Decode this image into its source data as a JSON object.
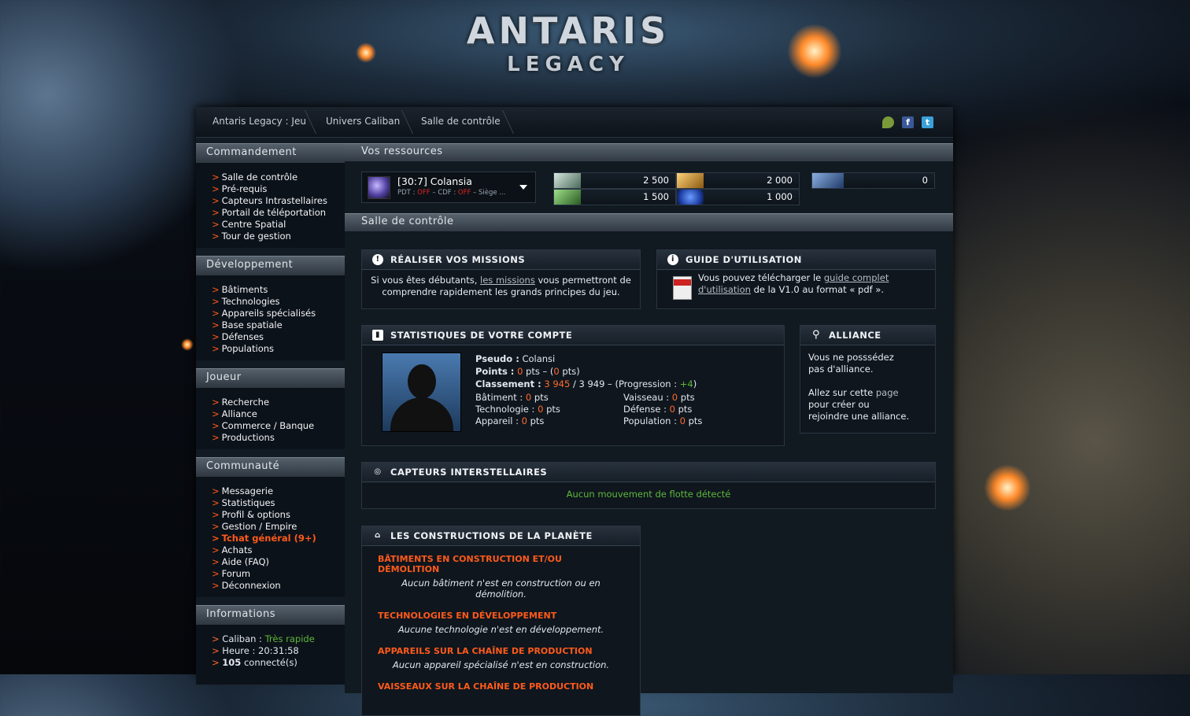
{
  "logo": {
    "line1": "ANTARIS",
    "line2": "LEGACY"
  },
  "breadcrumb": [
    "Antaris Legacy : Jeu",
    "Univers Caliban",
    "Salle de contrôle"
  ],
  "social": {
    "facebook": "f",
    "twitter": "t"
  },
  "sidebar": {
    "commandement": {
      "title": "Commandement",
      "items": [
        "Salle de contrôle",
        "Pré-requis",
        "Capteurs Intrastellaires",
        "Portail de téléportation",
        "Centre Spatial",
        "Tour de gestion"
      ]
    },
    "developpement": {
      "title": "Développement",
      "items": [
        "Bâtiments",
        "Technologies",
        "Appareils spécialisés",
        "Base spatiale",
        "Défenses",
        "Populations"
      ]
    },
    "joueur": {
      "title": "Joueur",
      "items": [
        "Recherche",
        "Alliance",
        "Commerce / Banque",
        "Productions"
      ]
    },
    "communaute": {
      "title": "Communauté",
      "items": [
        "Messagerie",
        "Statistiques",
        "Profil & options",
        "Gestion / Empire",
        "Tchat général (9+)",
        "Achats",
        "Aide (FAQ)",
        "Forum",
        "Déconnexion"
      ]
    },
    "informations": {
      "title": "Informations",
      "universe_label": "Caliban :",
      "universe_speed": "Très rapide",
      "time_label": "Heure :",
      "time_value": "20:31:58",
      "connected_count": "105",
      "connected_label": "connecté(s)"
    }
  },
  "resources": {
    "title": "Vos ressources",
    "planet": {
      "name": "[30:7] Colansia",
      "pdt_label": "PDT :",
      "pdt_value": "OFF",
      "sep": "–",
      "cdf_label": "CDF :",
      "cdf_value": "OFF",
      "seat": "– Siège ..."
    },
    "values": {
      "r1": "2 500",
      "r2": "1 500",
      "r3": "2 000",
      "r4": "1 000",
      "r5": "0"
    },
    "colors": {
      "metal": "#8fb7a0",
      "crystal": "#d8a02a",
      "blue": "#2a62d8"
    }
  },
  "control": {
    "title": "Salle de contrôle",
    "missions": {
      "title": "RÉALISER VOS MISSIONS",
      "text1": "Si vous êtes débutants,",
      "link": "les missions",
      "text2": "vous permettront de comprendre rapidement les grands principes du jeu."
    },
    "guide": {
      "title": "GUIDE D'UTILISATION",
      "text1": "Vous pouvez télécharger le",
      "link": "guide complet d'utilisation",
      "text2": "de la V1.0 au format « pdf »."
    },
    "stats": {
      "title": "STATISTIQUES DE VOTRE COMPTE",
      "pseudo_label": "Pseudo :",
      "pseudo": "Colansi",
      "points_label": "Points :",
      "points": "0",
      "points_unit": "pts – (",
      "points_sub": "0",
      "points_end": "pts)",
      "rank_label": "Classement :",
      "rank": "3 945",
      "rank_total": "/ 3 949 – (Progression :",
      "rank_prog": "+4",
      "rank_end": ")",
      "grid": [
        {
          "label": "Bâtiment :",
          "value": "0",
          "unit": "pts"
        },
        {
          "label": "Vaisseau :",
          "value": "0",
          "unit": "pts"
        },
        {
          "label": "Technologie :",
          "value": "0",
          "unit": "pts"
        },
        {
          "label": "Défense :",
          "value": "0",
          "unit": "pts"
        },
        {
          "label": "Appareil :",
          "value": "0",
          "unit": "pts"
        },
        {
          "label": "Population :",
          "value": "0",
          "unit": "pts"
        }
      ]
    },
    "alliance": {
      "title": "ALLIANCE",
      "line1": "Vous ne posssédez",
      "line2": "pas d'alliance.",
      "line3": "Allez sur cette",
      "link": "page",
      "line4": "pour créer ou",
      "line5": "rejoindre une alliance."
    },
    "sensors": {
      "title": "CAPTEURS INTERSTELLAIRES",
      "text": "Aucun mouvement de flotte détecté"
    },
    "constructions": {
      "title": "LES CONSTRUCTIONS DE LA PLANÈTE",
      "sections": [
        {
          "title": "BÂTIMENTS EN CONSTRUCTION ET/OU DÉMOLITION",
          "text": "Aucun bâtiment n'est en construction ou en démolition."
        },
        {
          "title": "TECHNOLOGIES EN DÉVELOPPEMENT",
          "text": "Aucune technologie n'est en développement."
        },
        {
          "title": "APPAREILS SUR LA CHAÎNE DE PRODUCTION",
          "text": "Aucun appareil spécialisé n'est en construction."
        },
        {
          "title": "VAISSEAUX SUR LA CHAÎNE DE PRODUCTION",
          "text": ""
        }
      ]
    }
  }
}
